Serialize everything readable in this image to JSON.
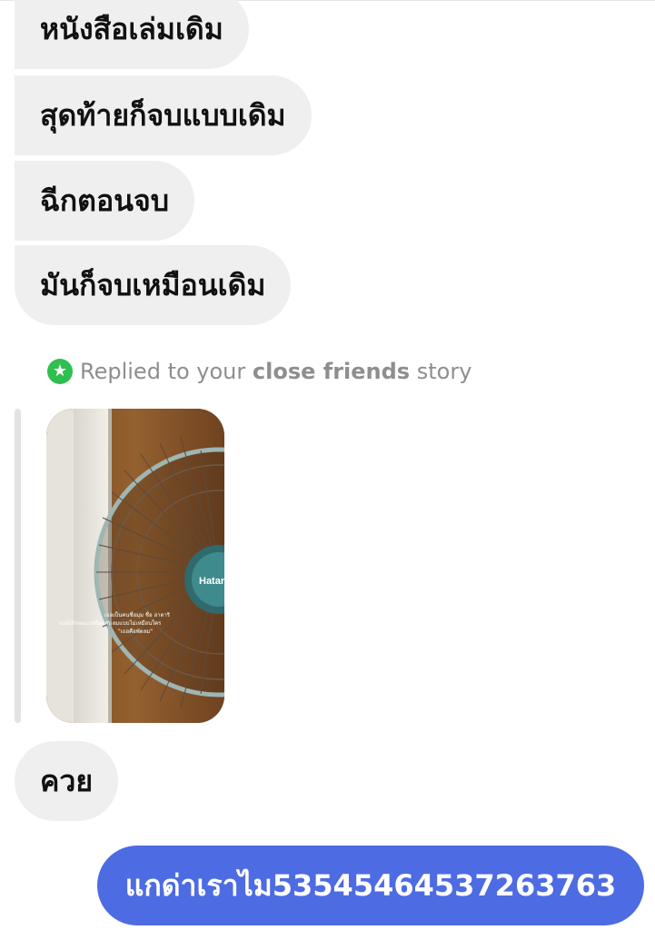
{
  "messages": {
    "incoming": [
      "หนังสือเล่มเดิม",
      "สุดท้ายก็จบแบบเดิม",
      "ฉีกตอนจบ",
      "มันก็จบเหมือนเดิม"
    ],
    "story_reply": {
      "prefix": "Replied to your",
      "emphasis": "close friends",
      "suffix": "story",
      "icon": "star-icon",
      "badge_color": "#2fbf4f",
      "fan_brand": "Hatari",
      "caption_lines": [
        "เธอเป็นคนชื่อมุม ชื่อ ฮาตาริ",
        "เธอมีลักษณะเหมือนพัดลมแบบไม่เหมือนใคร",
        "\"เธอคือพัดลม\""
      ]
    },
    "reply_text": "ควย",
    "outgoing": "แกด่าเราไม53545464537263763"
  },
  "colors": {
    "incoming_bubble": "#efefef",
    "outgoing_bubble": "#4d6be2",
    "meta_text": "#8e8e8e"
  }
}
